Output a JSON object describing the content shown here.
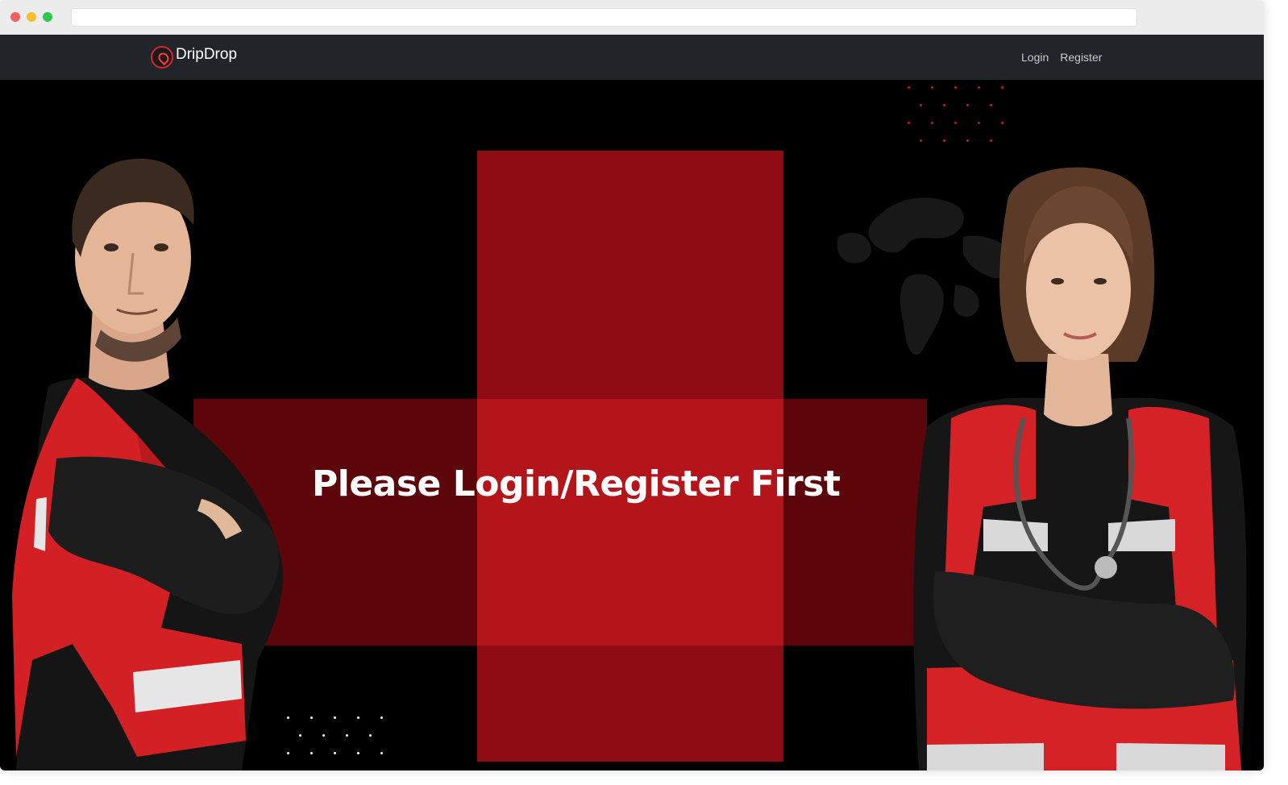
{
  "browser": {
    "url": ""
  },
  "navbar": {
    "brand": "DripDrop",
    "links": [
      {
        "label": "Login"
      },
      {
        "label": "Register"
      }
    ]
  },
  "hero": {
    "message": "Please Login/Register First",
    "colors": {
      "cross_vertical": "#8f0c15",
      "cross_horizontal": "#5c050b",
      "cross_center": "#b4151b",
      "background": "#000000"
    }
  },
  "images": {
    "left": "male-paramedic-photo",
    "right": "female-paramedic-photo"
  }
}
